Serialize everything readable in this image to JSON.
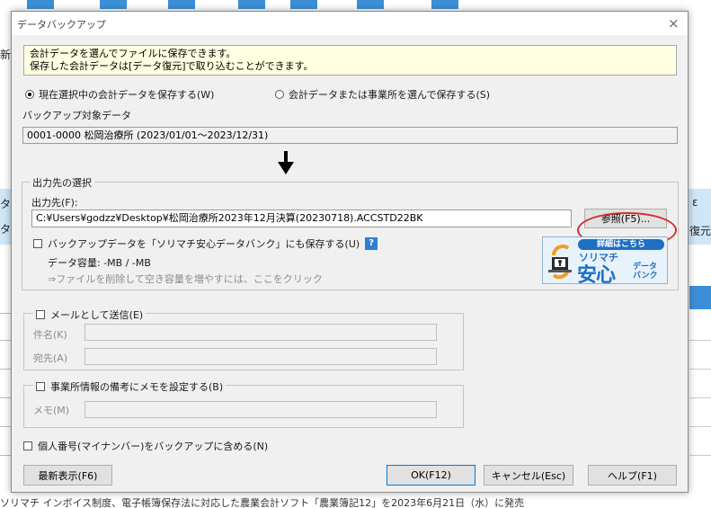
{
  "background": {
    "left_fragments": [
      "新規",
      "タ",
      "タ"
    ],
    "right_fragments": [
      "ε",
      "復元"
    ],
    "bottom_text": "ソリマチ インボイス制度、電子帳簿保存法に対応した農業会計ソフト「農業簿記12」を2023年6月21日（水）に発売",
    "accent_color": "#3c8fd6",
    "band_color": "#cfe6f7"
  },
  "dialog": {
    "title": "データバックアップ",
    "close_label": "×",
    "info": {
      "line1": "会計データを選んでファイルに保存できます。",
      "line2": "保存した会計データは[データ復元]で取り込むことができます。"
    },
    "radio_current": {
      "label": "現在選択中の会計データを保存する(W)",
      "selected": true
    },
    "radio_select": {
      "label": "会計データまたは事業所を選んで保存する(S)",
      "selected": false
    },
    "target_label": "バックアップ対象データ",
    "target_value": "0001-0000 松岡治療所 (2023/01/01～2023/12/31)",
    "output_group": {
      "title": "出力先の選択",
      "dest_label": "出力先(F):",
      "dest_value": "C:¥Users¥godzz¥Desktop¥松岡治療所2023年12月決算(20230718).ACCSTD22BK",
      "browse_button": "参照(F5)...",
      "databank_checkbox": "バックアップデータを「ソリマチ安心データバンク」にも保存する(U)",
      "help_badge": "?",
      "capacity": "データ容量:  -MB / -MB",
      "hint": "⇒ファイルを削除して空き容量を増やすには、ここをクリック"
    },
    "banner": {
      "pill": "詳細はこちら",
      "brand": "ソリマチ",
      "main": "安心",
      "sub1": "データ",
      "sub2": "バンク"
    },
    "mail_group": {
      "checkbox": "メールとして送信(E)",
      "subject_label": "件名(K)",
      "subject_value": "",
      "to_label": "宛先(A)",
      "to_value": ""
    },
    "memo_group": {
      "checkbox": "事業所情報の備考にメモを設定する(B)",
      "memo_label": "メモ(M)",
      "memo_value": ""
    },
    "mynumber_checkbox": "個人番号(マイナンバー)をバックアップに含める(N)",
    "buttons": {
      "refresh": "最新表示(F6)",
      "ok": "OK(F12)",
      "cancel": "キャンセル(Esc)",
      "help": "ヘルプ(F1)"
    }
  }
}
